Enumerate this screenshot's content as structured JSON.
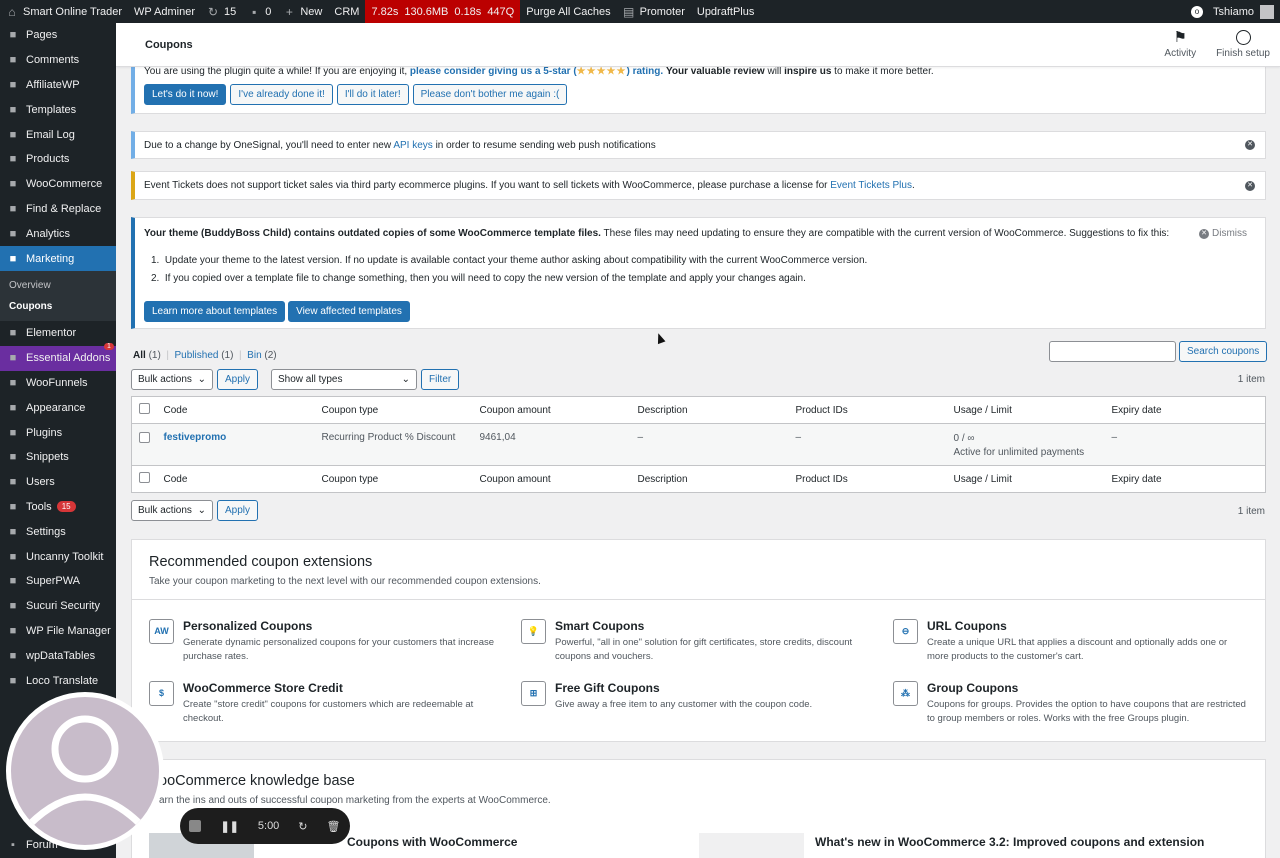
{
  "adminbar": {
    "site_name": "Smart Online Trader",
    "wp_adminer": "WP Adminer",
    "updates_count": "15",
    "comments_count": "0",
    "new_label": "New",
    "crm_label": "CRM",
    "perf": {
      "time": "7.82s",
      "memory": "130.6MB",
      "db_time": "0.18s",
      "queries": "447Q"
    },
    "purge": "Purge All Caches",
    "promoter": "Promoter",
    "updraft": "UpdraftPlus",
    "user": "Tshiamo"
  },
  "sidebar": {
    "items": [
      {
        "label": "Pages",
        "icon": "pages-icon"
      },
      {
        "label": "Comments",
        "icon": "comments-icon"
      },
      {
        "label": "AffiliateWP",
        "icon": "affiliate-icon"
      },
      {
        "label": "Templates",
        "icon": "templates-icon"
      },
      {
        "label": "Email Log",
        "icon": "email-icon"
      },
      {
        "label": "Products",
        "icon": "products-icon"
      },
      {
        "label": "WooCommerce",
        "icon": "woocommerce-icon"
      },
      {
        "label": "Find & Replace",
        "icon": "find-replace-icon"
      },
      {
        "label": "Analytics",
        "icon": "analytics-icon"
      },
      {
        "label": "Marketing",
        "icon": "marketing-icon"
      }
    ],
    "sub_overview": "Overview",
    "sub_coupons": "Coupons",
    "items2": [
      {
        "label": "Elementor",
        "icon": "elementor-icon"
      },
      {
        "label": "Essential Addons",
        "icon": "essential-addons-icon",
        "badge": "1"
      },
      {
        "label": "WooFunnels",
        "icon": "woofunnels-icon"
      },
      {
        "label": "Appearance",
        "icon": "appearance-icon"
      },
      {
        "label": "Plugins",
        "icon": "plugins-icon"
      },
      {
        "label": "Snippets",
        "icon": "snippets-icon"
      },
      {
        "label": "Users",
        "icon": "users-icon"
      },
      {
        "label": "Tools",
        "icon": "tools-icon",
        "count": "15"
      },
      {
        "label": "Settings",
        "icon": "settings-icon"
      },
      {
        "label": "Uncanny Toolkit",
        "icon": "uncanny-icon"
      },
      {
        "label": "SuperPWA",
        "icon": "superpwa-icon"
      },
      {
        "label": "Sucuri Security",
        "icon": "sucuri-icon"
      },
      {
        "label": "WP File Manager",
        "icon": "file-manager-icon"
      },
      {
        "label": "wpDataTables",
        "icon": "wpdatatables-icon"
      },
      {
        "label": "Loco Translate",
        "icon": "loco-icon"
      }
    ],
    "forum": "Forum"
  },
  "header": {
    "title": "Coupons",
    "activity": "Activity",
    "finish_setup": "Finish setup"
  },
  "review_notice": {
    "text_pre": "You are using the plugin quite a while! If you are enjoying it,",
    "link": "please consider giving us a 5-star (",
    "stars": "★★★★★",
    "link_end": ") rating.",
    "bold1": "Your valuable review",
    "mid": "will",
    "bold2": "inspire us",
    "end": "to make it more better.",
    "btn_do": "Let's do it now!",
    "btn_done": "I've already done it!",
    "btn_later": "I'll do it later!",
    "btn_never": "Please don't bother me again :("
  },
  "onesignal_notice": {
    "pre": "Due to a change by OneSignal, you'll need to enter new",
    "link": "API keys",
    "post": "in order to resume sending web push notifications"
  },
  "tickets_notice": {
    "pre": "Event Tickets does not support ticket sales via third party ecommerce plugins. If you want to sell tickets with WooCommerce, please purchase a license for",
    "link": "Event Tickets Plus",
    "post": "."
  },
  "theme_notice": {
    "bold": "Your theme (BuddyBoss Child) contains outdated copies of some WooCommerce template files.",
    "rest": "These files may need updating to ensure they are compatible with the current version of WooCommerce. Suggestions to fix this:",
    "dismiss": "Dismiss",
    "step1": "Update your theme to the latest version. If no update is available contact your theme author asking about compatibility with the current WooCommerce version.",
    "step2": "If you copied over a template file to change something, then you will need to copy the new version of the template and apply your changes again.",
    "btn_learn": "Learn more about templates",
    "btn_view": "View affected templates"
  },
  "filters": {
    "all": "All",
    "all_count": "(1)",
    "published": "Published",
    "published_count": "(1)",
    "bin": "Bin",
    "bin_count": "(2)",
    "search_button": "Search coupons",
    "bulk_actions": "Bulk actions",
    "apply": "Apply",
    "types": "Show all types",
    "filter": "Filter",
    "items_count": "1 item"
  },
  "table": {
    "columns": [
      "Code",
      "Coupon type",
      "Coupon amount",
      "Description",
      "Product IDs",
      "Usage / Limit",
      "Expiry date"
    ],
    "rows": [
      {
        "code": "festivepromo",
        "type": "Recurring Product % Discount",
        "amount": "9461,04",
        "description": "–",
        "product_ids": "–",
        "usage": "0 / ∞",
        "usage_note": "Active for unlimited payments",
        "expiry": "–"
      }
    ]
  },
  "extensions": {
    "title": "Recommended coupon extensions",
    "subtitle": "Take your coupon marketing to the next level with our recommended coupon extensions.",
    "items": [
      {
        "title": "Personalized Coupons",
        "desc": "Generate dynamic personalized coupons for your customers that increase purchase rates.",
        "icon": "AW"
      },
      {
        "title": "Smart Coupons",
        "desc": "Powerful, \"all in one\" solution for gift certificates, store credits, discount coupons and vouchers.",
        "icon": "lightbulb-icon"
      },
      {
        "title": "URL Coupons",
        "desc": "Create a unique URL that applies a discount and optionally adds one or more products to the customer's cart.",
        "icon": "link-icon"
      },
      {
        "title": "WooCommerce Store Credit",
        "desc": "Create \"store credit\" coupons for customers which are redeemable at checkout.",
        "icon": "dollar-icon"
      },
      {
        "title": "Free Gift Coupons",
        "desc": "Give away a free item to any customer with the coupon code.",
        "icon": "gift-icon"
      },
      {
        "title": "Group Coupons",
        "desc": "Coupons for groups. Provides the option to have coupons that are restricted to group members or roles. Works with the free Groups plugin.",
        "icon": "group-icon"
      }
    ]
  },
  "knowledge": {
    "title": "ooCommerce knowledge base",
    "subtitle": "arn the ins and outs of successful coupon marketing from the experts at WooCommerce.",
    "article1": "Coupons with WooCommerce",
    "article2": "What's new in WooCommerce 3.2: Improved coupons and extension"
  },
  "recorder": {
    "time": "5:00"
  }
}
